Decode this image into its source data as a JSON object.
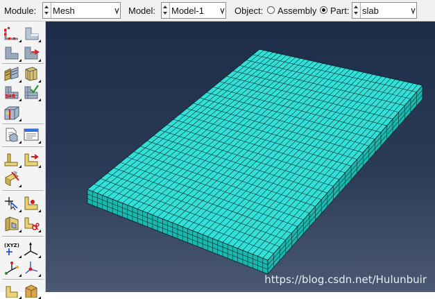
{
  "context_bar": {
    "module_label": "Module:",
    "module_value": "Mesh",
    "model_label": "Model:",
    "model_value": "Model-1",
    "object_label": "Object:",
    "object_options": {
      "assembly": "Assembly",
      "part": "Part:"
    },
    "object_selected": "Part",
    "part_value": "slab"
  },
  "toolbox": {
    "groups": [
      {
        "name": "seed-tools",
        "icons": [
          "seed-part-icon",
          "seed-edges-icon",
          "delete-part-seeds-icon",
          "delete-edge-seeds-icon"
        ]
      },
      {
        "name": "mesh-controls",
        "icons": [
          "assign-mesh-controls-icon",
          "assign-element-type-icon",
          "mesh-part-icon",
          "verify-mesh-icon",
          "partition-cell-icon"
        ]
      },
      {
        "name": "query-tools",
        "icons": [
          "query-info-icon",
          "edit-mesh-icon"
        ]
      },
      {
        "name": "datum-tools",
        "icons": [
          "create-datum-point-icon",
          "datum-axis-icon",
          "datum-plane-icon"
        ]
      },
      {
        "name": "partition-tools",
        "icons": [
          "partition-edge-icon",
          "partition-face-icon",
          "partition-cell-extrude-icon",
          "partition-cell-cut-icon"
        ]
      },
      {
        "name": "csys-tools",
        "icons": [
          "datum-csys-icon",
          "create-csys-triad-icon",
          "datum-plane-triad-icon",
          "rotate-triad-icon"
        ]
      },
      {
        "name": "extra-tools",
        "icons": [
          "virtual-topology-icon",
          "repair-icon"
        ]
      }
    ],
    "xyz_label": "(XYZ)"
  },
  "viewport": {
    "mesh_color": "#33e0d8",
    "mesh_side_color": "#1bb8b0",
    "mesh_line_color": "#0b2a2a",
    "background_top": "#1d2c48",
    "background_bottom": "#4a5872",
    "mesh_divisions": {
      "length": 36,
      "width": 26,
      "thickness": 3
    }
  },
  "watermark": "https://blog.csdn.net/Hulunbuir"
}
